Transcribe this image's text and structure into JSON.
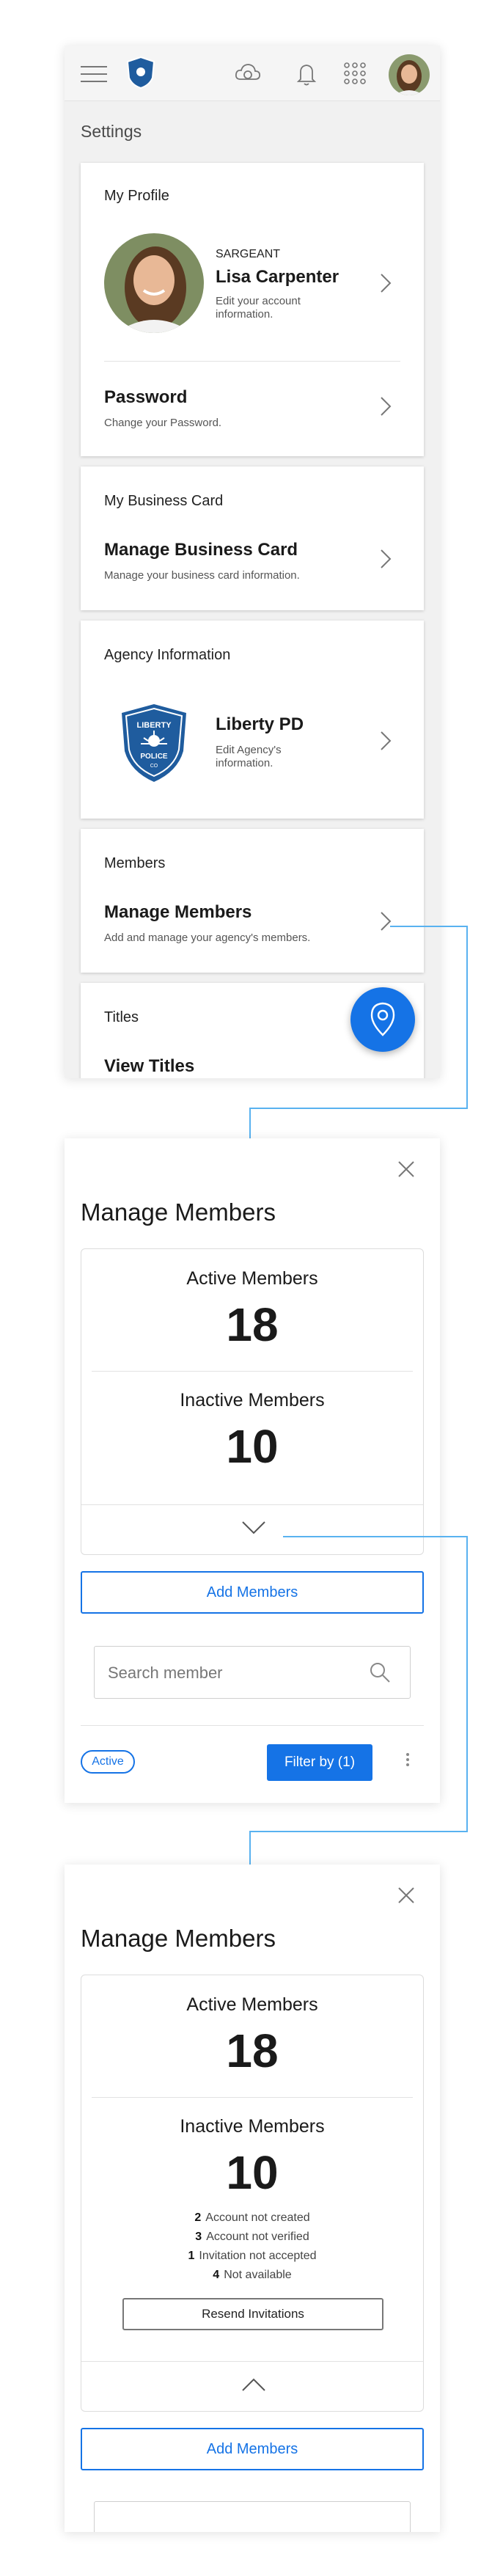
{
  "colors": {
    "accent": "#1573e6",
    "connector": "#59b2f0",
    "badge": "#1f5c9e"
  },
  "topbar": {
    "icons": [
      "menu-icon",
      "agency-badge-logo",
      "cloud-sync-icon",
      "bell-icon",
      "apps-grid-icon",
      "user-avatar"
    ]
  },
  "settings": {
    "title": "Settings",
    "profile": {
      "section": "My Profile",
      "rank": "SARGEANT",
      "name": "Lisa Carpenter",
      "desc": "Edit your account information.",
      "password_label": "Password",
      "password_desc": "Change your Password."
    },
    "business_card": {
      "section": "My Business Card",
      "label": "Manage Business Card",
      "desc": "Manage your business card information."
    },
    "agency": {
      "section": "Agency Information",
      "name": "Liberty PD",
      "desc": "Edit Agency's information.",
      "logo_text_top": "LIBERTY",
      "logo_text_mid": "POLICE",
      "logo_text_bottom": "CO"
    },
    "members": {
      "section": "Members",
      "label": "Manage Members",
      "desc": "Add and manage your agency's members."
    },
    "titles": {
      "section": "Titles",
      "label": "View Titles"
    }
  },
  "manage_members": {
    "title": "Manage Members",
    "active_label": "Active Members",
    "active_count": "18",
    "inactive_label": "Inactive Members",
    "inactive_count": "10",
    "add_button": "Add Members",
    "search_placeholder": "Search member",
    "chip": "Active",
    "filter_button": "Filter by (1)"
  },
  "manage_members_expanded": {
    "title": "Manage Members",
    "active_label": "Active Members",
    "active_count": "18",
    "inactive_label": "Inactive Members",
    "inactive_count": "10",
    "details": [
      {
        "count": "2",
        "label": "Account not created"
      },
      {
        "count": "3",
        "label": "Account not verified"
      },
      {
        "count": "1",
        "label": "Invitation not accepted"
      },
      {
        "count": "4",
        "label": "Not available"
      }
    ],
    "resend_button": "Resend Invitations",
    "add_button": "Add Members"
  }
}
